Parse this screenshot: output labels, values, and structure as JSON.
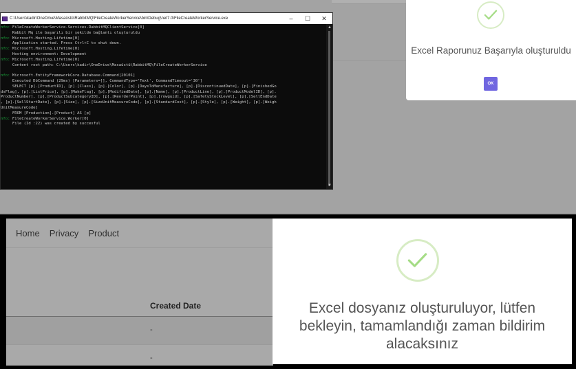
{
  "console": {
    "title": "C:\\Users\\kadir\\OneDrive\\Masaüstü\\RabbitMQ\\FileCreateWorkerService\\bin\\Debug\\net7.0\\FileCreateWorkerService.exe",
    "controls": {
      "minimize": "–",
      "maximize": "☐",
      "close": "✕"
    },
    "lines": [
      {
        "prefix": "nfo:",
        "text": " FileCreateWorkerService.Services.RabbitMQClientService[0]"
      },
      {
        "prefix": "",
        "text": "     Rabbit Mq ile başarılı bir şekilde bağlantı oluşturuldu"
      },
      {
        "prefix": "nfo:",
        "text": " Microsoft.Hosting.Lifetime[0]"
      },
      {
        "prefix": "",
        "text": "     Application started. Press Ctrl+C to shut down."
      },
      {
        "prefix": "nfo:",
        "text": " Microsoft.Hosting.Lifetime[0]"
      },
      {
        "prefix": "",
        "text": "     Hosting environment: Development"
      },
      {
        "prefix": "nfo:",
        "text": " Microsoft.Hosting.Lifetime[0]"
      },
      {
        "prefix": "",
        "text": "     Content root path: C:\\Users\\kadir\\OneDrive\\Masaüstü\\RabbitMQ\\FileCreateWorkerService"
      },
      {
        "prefix": "",
        "text": ""
      },
      {
        "prefix": "nfo:",
        "text": " Microsoft.EntityFrameworkCore.Database.Command[20101]"
      },
      {
        "prefix": "",
        "text": "     Executed DbCommand (29ms) [Parameters=[], CommandType='Text', CommandTimeout='30']"
      },
      {
        "prefix": "",
        "text": "     SELECT [p].[ProductID], [p].[Class], [p].[Color], [p].[DaysToManufacture], [p].[DiscontinuedDate], [p].[FinishedGo"
      },
      {
        "prefix": "",
        "text": "dsFlag], [p].[ListPrice], [p].[MakeFlag], [p].[ModifiedDate], [p].[Name], [p].[ProductLine], [p].[ProductModelID], [p]."
      },
      {
        "prefix": "",
        "text": "ProductNumber], [p].[ProductSubcategoryID], [p].[ReorderPoint], [p].[rowguid], [p].[SafetyStockLevel], [p].[SellEndDate"
      },
      {
        "prefix": "",
        "text": ", [p].[SellStartDate], [p].[Size], [p].[SizeUnitMeasureCode], [p].[StandardCost], [p].[Style], [p].[Weight], [p].[Weigh"
      },
      {
        "prefix": "",
        "text": "UnitMeasureCode]"
      },
      {
        "prefix": "",
        "text": "     FROM [Production].[Product] AS [p]"
      },
      {
        "prefix": "nfo:",
        "text": " FileCreateWorkerService.Worker[0]"
      },
      {
        "prefix": "",
        "text": "     File (Id :22) was created by succesful"
      }
    ],
    "scroll_up": "▲",
    "scroll_down": "▼"
  },
  "modal_top": {
    "message": "Excel Raporunuz Başarıyla oluşturuldu",
    "ok_label": "OK",
    "icon": "success-check-icon"
  },
  "bottom_page": {
    "nav": [
      "Home",
      "Privacy",
      "Product"
    ],
    "table": {
      "header": "Created Date",
      "rows": [
        "-",
        "-"
      ]
    }
  },
  "modal_bottom": {
    "message": "Excel dosyanız oluşturuluyor, lütfen bekleyin, tamamlandığı zaman bildirim alacaksınız",
    "icon": "success-check-icon"
  },
  "colors": {
    "check_stroke": "#a5dc86",
    "ok_button": "#7066e0",
    "console_info": "#1aaa3c"
  }
}
